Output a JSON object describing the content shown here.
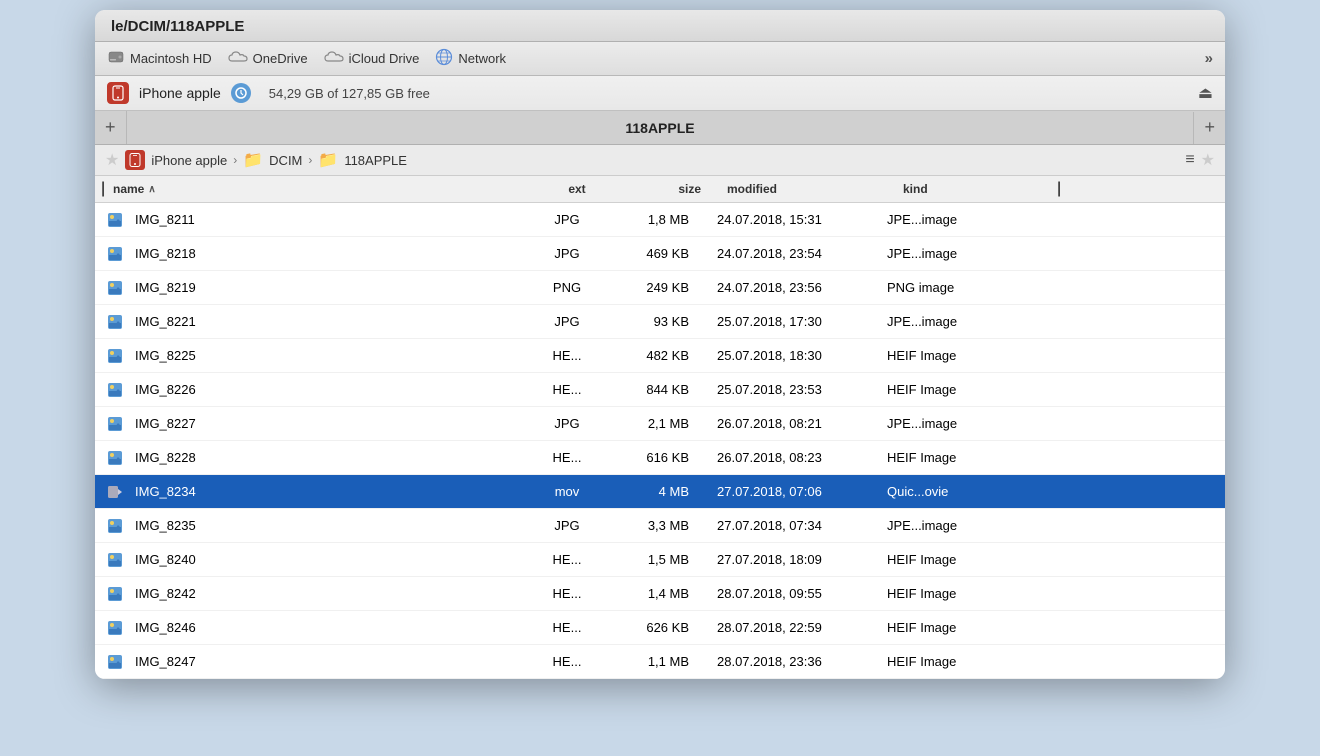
{
  "window": {
    "title": "le/DCIM/118APPLE"
  },
  "toolbar": {
    "items": [
      {
        "id": "macintosh-hd",
        "label": "Macintosh HD",
        "icon": "hard-drive-icon"
      },
      {
        "id": "onedrive",
        "label": "OneDrive",
        "icon": "cloud-icon"
      },
      {
        "id": "icloud-drive",
        "label": "iCloud Drive",
        "icon": "cloud-icon"
      },
      {
        "id": "network",
        "label": "Network",
        "icon": "globe-icon"
      }
    ],
    "more_label": "»"
  },
  "device_bar": {
    "name": "iPhone apple",
    "space": "54,29 GB of 127,85 GB free",
    "eject_icon": "eject-icon"
  },
  "tab_bar": {
    "add_left": "+",
    "tab_label": "118APPLE",
    "add_right": "+"
  },
  "breadcrumb": {
    "star_left": "★",
    "device_label": "iPhone apple",
    "arrow1": "›",
    "folder1_label": "DCIM",
    "arrow2": "›",
    "folder2_label": "118APPLE",
    "view_icon": "≡",
    "star_right": "★"
  },
  "columns": {
    "name": "name",
    "ext": "ext",
    "size": "size",
    "modified": "modified",
    "kind": "kind"
  },
  "files": [
    {
      "icon": "image",
      "name": "IMG_8211",
      "ext": "JPG",
      "size": "1,8 MB",
      "modified": "24.07.2018, 15:31",
      "kind": "JPE...image"
    },
    {
      "icon": "image",
      "name": "IMG_8218",
      "ext": "JPG",
      "size": "469 KB",
      "modified": "24.07.2018, 23:54",
      "kind": "JPE...image"
    },
    {
      "icon": "image",
      "name": "IMG_8219",
      "ext": "PNG",
      "size": "249 KB",
      "modified": "24.07.2018, 23:56",
      "kind": "PNG image"
    },
    {
      "icon": "image",
      "name": "IMG_8221",
      "ext": "JPG",
      "size": "93 KB",
      "modified": "25.07.2018, 17:30",
      "kind": "JPE...image"
    },
    {
      "icon": "image",
      "name": "IMG_8225",
      "ext": "HE...",
      "size": "482 KB",
      "modified": "25.07.2018, 18:30",
      "kind": "HEIF Image"
    },
    {
      "icon": "image",
      "name": "IMG_8226",
      "ext": "HE...",
      "size": "844 KB",
      "modified": "25.07.2018, 23:53",
      "kind": "HEIF Image"
    },
    {
      "icon": "image",
      "name": "IMG_8227",
      "ext": "JPG",
      "size": "2,1 MB",
      "modified": "26.07.2018, 08:21",
      "kind": "JPE...image"
    },
    {
      "icon": "image",
      "name": "IMG_8228",
      "ext": "HE...",
      "size": "616 KB",
      "modified": "26.07.2018, 08:23",
      "kind": "HEIF Image"
    },
    {
      "icon": "video",
      "name": "IMG_8234",
      "ext": "mov",
      "size": "4 MB",
      "modified": "27.07.2018, 07:06",
      "kind": "Quic...ovie",
      "selected": true
    },
    {
      "icon": "image",
      "name": "IMG_8235",
      "ext": "JPG",
      "size": "3,3 MB",
      "modified": "27.07.2018, 07:34",
      "kind": "JPE...image"
    },
    {
      "icon": "image",
      "name": "IMG_8240",
      "ext": "HE...",
      "size": "1,5 MB",
      "modified": "27.07.2018, 18:09",
      "kind": "HEIF Image"
    },
    {
      "icon": "image",
      "name": "IMG_8242",
      "ext": "HE...",
      "size": "1,4 MB",
      "modified": "28.07.2018, 09:55",
      "kind": "HEIF Image"
    },
    {
      "icon": "image",
      "name": "IMG_8246",
      "ext": "HE...",
      "size": "626 KB",
      "modified": "28.07.2018, 22:59",
      "kind": "HEIF Image"
    },
    {
      "icon": "image",
      "name": "IMG_8247",
      "ext": "HE...",
      "size": "1,1 MB",
      "modified": "28.07.2018, 23:36",
      "kind": "HEIF Image"
    }
  ]
}
